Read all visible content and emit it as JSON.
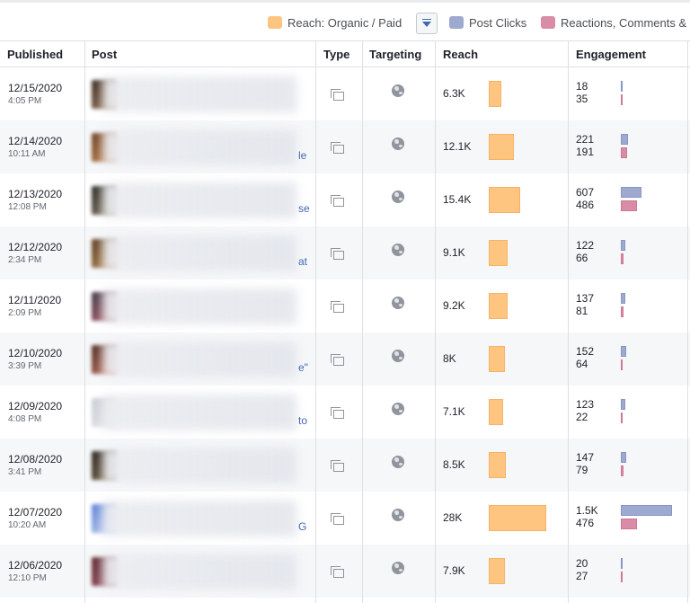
{
  "legend": {
    "reach_label": "Reach: Organic / Paid",
    "post_clicks_label": "Post Clicks",
    "reactions_label": "Reactions, Comments &",
    "colors": {
      "reach": "#fdc580",
      "post_clicks": "#9ea9cf",
      "reactions": "#d98ca6"
    }
  },
  "columns": {
    "published": "Published",
    "post": "Post",
    "type": "Type",
    "targeting": "Targeting",
    "reach": "Reach",
    "engagement": "Engagement"
  },
  "icons": {
    "type": "multi-photo-icon",
    "targeting": "globe-icon",
    "dropdown": "chevron-down-icon"
  },
  "max_reach": 28000,
  "max_clicks": 1500,
  "rows": [
    {
      "date": "12/15/2020",
      "time": "4:05 PM",
      "post_tail": "",
      "reach": "6.3K",
      "reach_value": 6300,
      "clicks": "18",
      "clicks_value": 18,
      "reactions": "35",
      "reactions_value": 35
    },
    {
      "date": "12/14/2020",
      "time": "10:11 AM",
      "post_tail": "le",
      "reach": "12.1K",
      "reach_value": 12100,
      "clicks": "221",
      "clicks_value": 221,
      "reactions": "191",
      "reactions_value": 191
    },
    {
      "date": "12/13/2020",
      "time": "12:08 PM",
      "post_tail": "se",
      "reach": "15.4K",
      "reach_value": 15400,
      "clicks": "607",
      "clicks_value": 607,
      "reactions": "486",
      "reactions_value": 486
    },
    {
      "date": "12/12/2020",
      "time": "2:34 PM",
      "post_tail": "at",
      "reach": "9.1K",
      "reach_value": 9100,
      "clicks": "122",
      "clicks_value": 122,
      "reactions": "66",
      "reactions_value": 66
    },
    {
      "date": "12/11/2020",
      "time": "2:09 PM",
      "post_tail": "",
      "reach": "9.2K",
      "reach_value": 9200,
      "clicks": "137",
      "clicks_value": 137,
      "reactions": "81",
      "reactions_value": 81
    },
    {
      "date": "12/10/2020",
      "time": "3:39 PM",
      "post_tail": "e\"",
      "reach": "8K",
      "reach_value": 8000,
      "clicks": "152",
      "clicks_value": 152,
      "reactions": "64",
      "reactions_value": 64
    },
    {
      "date": "12/09/2020",
      "time": "4:08 PM",
      "post_tail": "to",
      "reach": "7.1K",
      "reach_value": 7100,
      "clicks": "123",
      "clicks_value": 123,
      "reactions": "22",
      "reactions_value": 22
    },
    {
      "date": "12/08/2020",
      "time": "3:41 PM",
      "post_tail": "",
      "reach": "8.5K",
      "reach_value": 8500,
      "clicks": "147",
      "clicks_value": 147,
      "reactions": "79",
      "reactions_value": 79
    },
    {
      "date": "12/07/2020",
      "time": "10:20 AM",
      "post_tail": "G",
      "reach": "28K",
      "reach_value": 28000,
      "clicks": "1.5K",
      "clicks_value": 1500,
      "reactions": "476",
      "reactions_value": 476
    },
    {
      "date": "12/06/2020",
      "time": "12:10 PM",
      "post_tail": "",
      "reach": "7.9K",
      "reach_value": 7900,
      "clicks": "20",
      "clicks_value": 20,
      "reactions": "27",
      "reactions_value": 27
    }
  ]
}
